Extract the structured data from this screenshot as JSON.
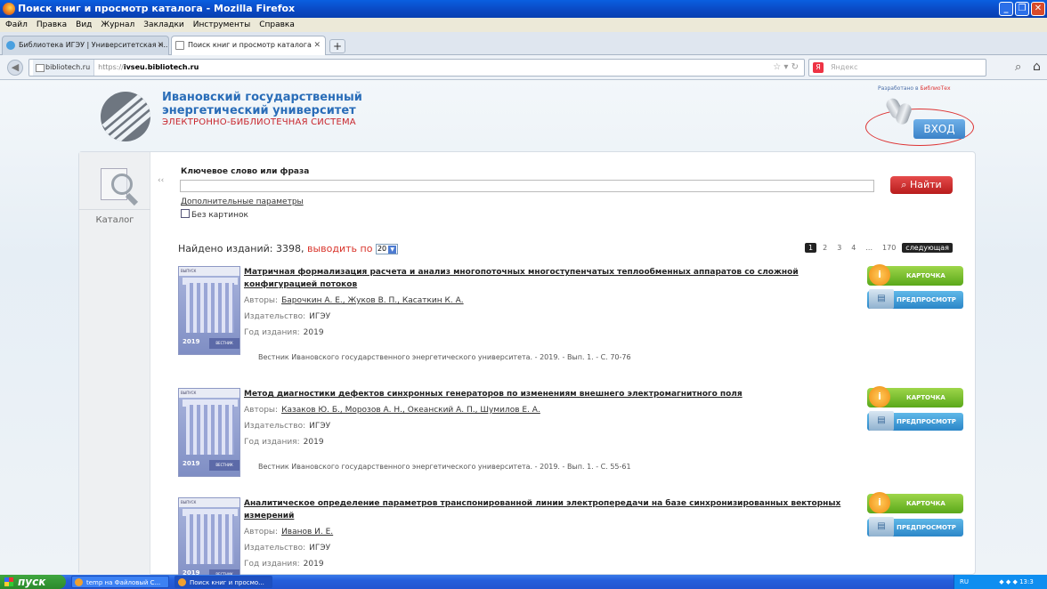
{
  "window": {
    "title": "Поиск книг и просмотр каталога - Mozilla Firefox"
  },
  "menu": [
    "Файл",
    "Правка",
    "Вид",
    "Журнал",
    "Закладки",
    "Инструменты",
    "Справка"
  ],
  "tabs": [
    {
      "label": "Библиотека ИГЭУ | Университетская н...",
      "active": false
    },
    {
      "label": "Поиск книг и просмотр каталога",
      "active": true
    }
  ],
  "addressbar": {
    "site": "bibliotech.ru",
    "scheme": "https://",
    "host": "ivseu.bibliotech.ru"
  },
  "search": {
    "placeholder": "Яндекс"
  },
  "header": {
    "uni_line1": "Ивановский государственный",
    "uni_line2": "энергетический университет",
    "uni_line3": "ЭЛЕКТРОННО-БИБЛИОТЕЧНАЯ СИСТЕМА",
    "developed_by": "Разработано в",
    "brand": "БиблиоТех",
    "login": "ВХОД"
  },
  "sidebar": {
    "catalog": "Каталог",
    "collapse": "‹‹"
  },
  "searchform": {
    "keyword_label": "Ключевое слово или фраза",
    "keyword_value": "",
    "find_button": "Найти",
    "advanced_link": "Дополнительные параметры",
    "no_images": "Без картинок"
  },
  "results": {
    "found_label": "Найдено изданий:",
    "found_count": "3398,",
    "show_by": "выводить по",
    "per_page": "20",
    "pages": [
      "1",
      "2",
      "3",
      "4",
      "...",
      "170"
    ],
    "next": "следующая"
  },
  "labels": {
    "authors": "Авторы:",
    "publisher": "Издательство:",
    "year": "Год издания:",
    "card": "КАРТОЧКА",
    "preview": "ПРЕДПРОСМОТР"
  },
  "items": [
    {
      "title": "Матричная формализация расчета и анализ многопоточных многоступенчатых теплообменных аппаратов со сложной конфигурацией потоков",
      "authors": "Барочкин А. Е., Жуков В. П., Касаткин К. А.",
      "publisher": "ИГЭУ",
      "year": "2019",
      "source": "Вестник Ивановского государственного энергетического университета. - 2019. - Вып. 1. - С. 70-76"
    },
    {
      "title": "Метод диагностики дефектов синхронных генераторов по изменениям внешнего электромагнитного поля",
      "authors": "Казаков Ю. Б., Морозов А. Н., Океанский А. П., Шумилов Е. А.",
      "publisher": "ИГЭУ",
      "year": "2019",
      "source": "Вестник Ивановского государственного энергетического университета. - 2019. - Вып. 1. - С. 55-61"
    },
    {
      "title": "Аналитическое определение параметров транспонированной линии электропередачи на базе синхронизированных векторных измерений",
      "authors": "Иванов И. Е.",
      "publisher": "ИГЭУ",
      "year": "2019",
      "source": ""
    }
  ],
  "taskbar": {
    "start": "пуск",
    "buttons": [
      "temp на Файловый С...",
      "Поиск книг и просмо..."
    ],
    "tray": "RU",
    "clock": "13:3"
  }
}
